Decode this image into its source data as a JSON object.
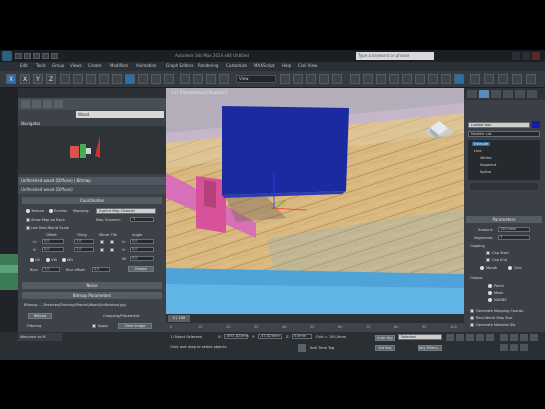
{
  "title": {
    "window": "Autodesk 3ds Max 2014 x64 Untitled",
    "search_placeholder": "Type a keyword or phrase"
  },
  "menu": [
    "Edit",
    "Tools",
    "Group",
    "Views",
    "Create",
    "Modifiers",
    "Animation",
    "Graph Editors",
    "Rendering",
    "Customize",
    "MAXScript",
    "Help",
    "Civil View"
  ],
  "toolbar": {
    "x_label": "X",
    "y_label": "Y",
    "z_label": "Z",
    "ref_coord": "View"
  },
  "material_editor": {
    "material_name": "Wood",
    "navigator_label": "Navigator",
    "slot_name": "Unfinished wood (Diffuse) | Bitmap",
    "sub_name": "Unfinished wood (Diffuse)",
    "coordinates_title": "Coordinates",
    "texture_label": "Texture",
    "environ_label": "Environ",
    "mapping_label": "Mapping:",
    "mapping_value": "Explicit Map Channel",
    "show_map_label": "Show Map on Back",
    "map_channel_label": "Map Channel:",
    "map_channel_value": "1",
    "real_world_label": "Use Real-World Scale",
    "offset_label": "Offset",
    "tiling_label": "Tiling",
    "mirror_tile_label": "Mirror Tile",
    "angle_label": "Angle",
    "u_label": "U:",
    "v_label": "V:",
    "w_label": "W:",
    "offset_u": "0,0",
    "offset_v": "0,0",
    "tiling_u": "1,0",
    "tiling_v": "1,0",
    "angle_u": "0,0",
    "angle_v": "0,0",
    "angle_w": "0,0",
    "uv_label": "UV",
    "vw_label": "VW",
    "wu_label": "WU",
    "blur_label": "Blur:",
    "blur_value": "1,0",
    "blur_offset_label": "Blur offset:",
    "blur_offset_value": "0,0",
    "rotate_label": "Rotate",
    "noise_title": "Noise",
    "bitmap_params_title": "Bitmap Parameters",
    "bitmap_path": "Bitmap: ...\\Textures\\Flooring\\Planks\\Wood\\Unfinished.jpg",
    "reload_label": "Reload",
    "cropping_label": "Cropping/Placement",
    "filtering_label": "Filtering",
    "pyramidal_label": "Pyramidal",
    "summed_label": "Summed Area",
    "none_label": "None",
    "apply_label": "Apply",
    "view_image_label": "View Image",
    "crop_label": "Crop",
    "place_label": "Place"
  },
  "viewport": {
    "label": "[+] [Perspective] [Realistic]"
  },
  "command_panel": {
    "object_name": "Lumber box",
    "modifier_list": "Modifier List",
    "stack_items": [
      "Extrude",
      "Line",
      "Vertex",
      "Segment",
      "Spline"
    ],
    "parameters_title": "Parameters",
    "amount_label": "Amount:",
    "amount_value": "150,0mm",
    "segments_label": "Segments:",
    "segments_value": "1",
    "capping_label": "Capping",
    "cap_start_label": "Cap Start",
    "cap_end_label": "Cap End",
    "morph_label": "Morph",
    "grid_label": "Grid",
    "output_label": "Output",
    "patch_label": "Patch",
    "mesh_label": "Mesh",
    "nurbs_label": "NURBS",
    "gen_mapping_label": "Generate Mapping Coords.",
    "real_world_map_label": "Real-World Map Size",
    "gen_mat_ids_label": "Generate Material IDs"
  },
  "timeline": {
    "frame_readout": "0 / 100",
    "ticks": [
      "0",
      "10",
      "20",
      "30",
      "40",
      "50",
      "60",
      "70",
      "80",
      "90",
      "100"
    ]
  },
  "status": {
    "selection": "1 Object Selected",
    "prompt": "Click and drag to select objects",
    "x_label": "X:",
    "x_value": "1091,823mm",
    "y_label": "Y:",
    "y_value": "-47,823mm",
    "z_label": "Z:",
    "z_value": "0,0mm",
    "grid_label": "Grid = 100,0mm",
    "auto_key": "Auto Key",
    "selected_value": "Selected",
    "set_key": "Set Key",
    "key_filters": "Key Filters...",
    "add_time_tag": "Add Time Tag",
    "welcome": "Welcome to M"
  },
  "colors": {
    "ui_dark": "#3d4248",
    "viewport_bg": "#a09aa9",
    "floor_wood": "#d6b47a",
    "blue_box": "#1b2a9e",
    "pink_box": "#d8529a",
    "selection_blue": "#2f6fa8"
  }
}
